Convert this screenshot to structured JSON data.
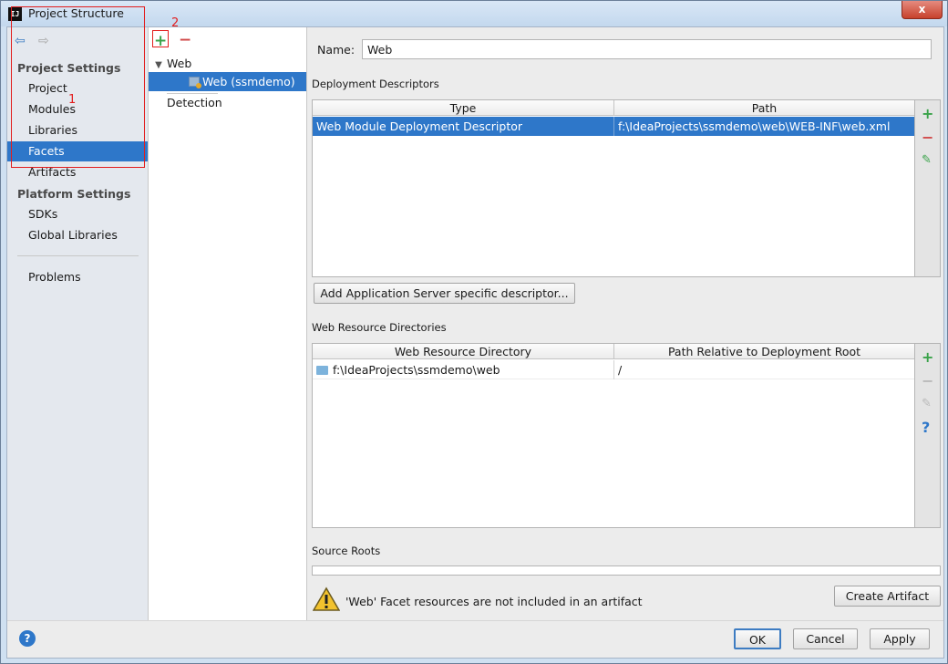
{
  "window": {
    "title": "Project Structure",
    "icon_text": "IJ",
    "close_glyph": "x"
  },
  "nav": {
    "back": "⇦",
    "forward": "⇨"
  },
  "sidebar": {
    "project_settings_header": "Project Settings",
    "items": [
      {
        "label": "Project"
      },
      {
        "label": "Modules"
      },
      {
        "label": "Libraries"
      },
      {
        "label": "Facets",
        "selected": true
      },
      {
        "label": "Artifacts"
      }
    ],
    "platform_settings_header": "Platform Settings",
    "platform_items": [
      {
        "label": "SDKs"
      },
      {
        "label": "Global Libraries"
      }
    ],
    "problems_label": "Problems"
  },
  "annotations": {
    "box1_number": "1",
    "box2_number": "2"
  },
  "facet_tree": {
    "add_glyph": "+",
    "remove_glyph": "−",
    "root_label": "Web",
    "child_label": "Web (ssmdemo)",
    "detection_label": "Detection"
  },
  "facet": {
    "name_label": "Name:",
    "name_value": "Web",
    "deployment": {
      "section_title": "Deployment Descriptors",
      "columns": [
        "Type",
        "Path"
      ],
      "rows": [
        {
          "type": "Web Module Deployment Descriptor",
          "path": "f:\\IdeaProjects\\ssmdemo\\web\\WEB-INF\\web.xml"
        }
      ],
      "add_server_descriptor_button": "Add Application Server specific descriptor..."
    },
    "resources": {
      "section_title": "Web Resource Directories",
      "columns": [
        "Web Resource Directory",
        "Path Relative to Deployment Root"
      ],
      "rows": [
        {
          "directory": "f:\\IdeaProjects\\ssmdemo\\web",
          "relative": "/"
        }
      ]
    },
    "source_roots_title": "Source Roots",
    "warning_text": "'Web' Facet resources are not included in an artifact",
    "create_artifact_button": "Create Artifact"
  },
  "side_buttons": {
    "add": "+",
    "remove": "−",
    "edit": "✎",
    "help": "?"
  },
  "footer": {
    "help_glyph": "?",
    "ok": "OK",
    "cancel": "Cancel",
    "apply": "Apply"
  },
  "colors": {
    "selection": "#2e77c9",
    "add": "#3aa34a",
    "remove": "#d14a4a",
    "annotation": "#e21d1d"
  }
}
